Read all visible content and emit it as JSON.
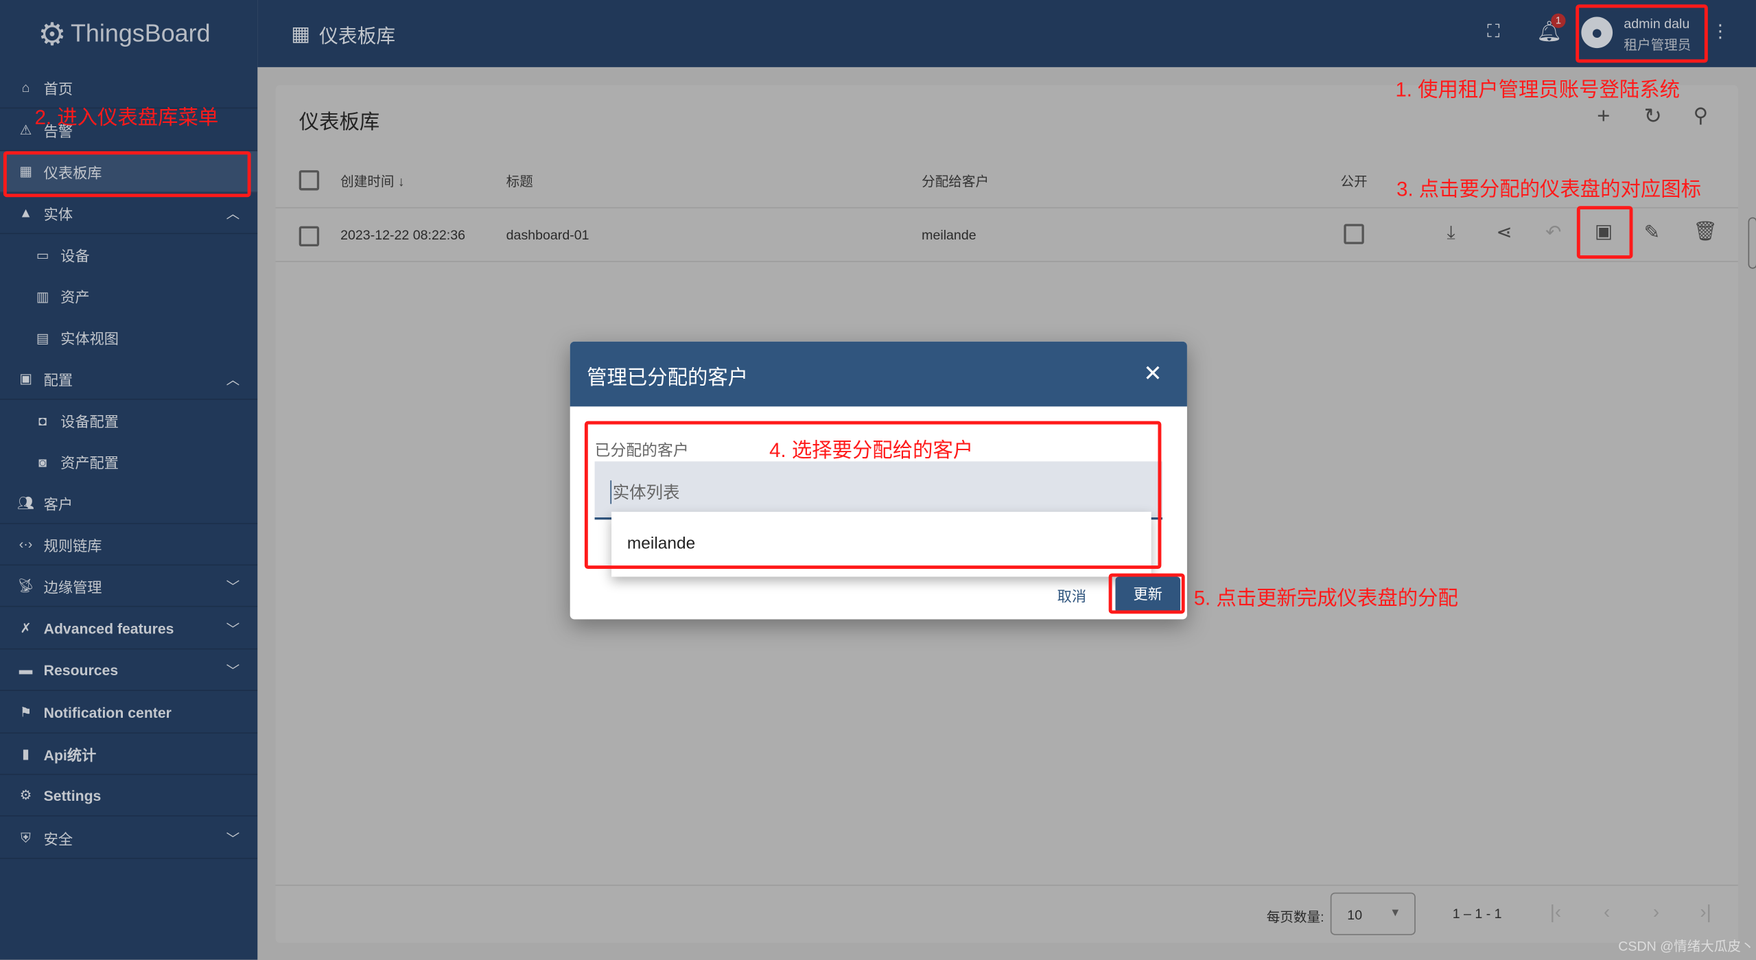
{
  "app": {
    "brand": "ThingsBoard",
    "page_title": "仪表板库"
  },
  "colors": {
    "primary": "#305680",
    "sidebar": "#213858",
    "annotation": "#ff1a1a",
    "badge": "#c62828"
  },
  "sidebar": {
    "items": [
      {
        "label": "首页",
        "icon": "home-icon"
      },
      {
        "label": "告警",
        "icon": "warning-icon"
      },
      {
        "label": "仪表板库",
        "icon": "dashboard-icon",
        "selected": true
      },
      {
        "label": "实体",
        "icon": "shapes-icon",
        "expanded": true
      },
      {
        "label": "设备",
        "icon": "devices-icon",
        "sub": true
      },
      {
        "label": "资产",
        "icon": "domain-icon",
        "sub": true
      },
      {
        "label": "实体视图",
        "icon": "view-quilt-icon",
        "sub": true
      },
      {
        "label": "配置",
        "icon": "settings-box-icon",
        "expanded": true
      },
      {
        "label": "设备配置",
        "icon": "device-profile-icon",
        "sub": true
      },
      {
        "label": "资产配置",
        "icon": "asset-profile-icon",
        "sub": true
      },
      {
        "label": "客户",
        "icon": "people-icon"
      },
      {
        "label": "规则链库",
        "icon": "settings-ethernet-icon"
      },
      {
        "label": "边缘管理",
        "icon": "router-icon",
        "collapsed": true
      },
      {
        "label": "Advanced features",
        "icon": "build-icon",
        "collapsed": true
      },
      {
        "label": "Resources",
        "icon": "folder-icon",
        "collapsed": true
      },
      {
        "label": "Notification center",
        "icon": "notification-icon"
      },
      {
        "label": "Api统计",
        "icon": "analytics-icon"
      },
      {
        "label": "Settings",
        "icon": "gear-icon"
      },
      {
        "label": "安全",
        "icon": "security-icon",
        "collapsed": true
      }
    ]
  },
  "topbar": {
    "notification_count": "1",
    "user_name": "admin dalu",
    "user_role": "租户管理员"
  },
  "table": {
    "title": "仪表板库",
    "columns": [
      "创建时间",
      "标题",
      "分配给客户",
      "公开"
    ],
    "rows": [
      {
        "created": "2023-12-22 08:22:36",
        "title": "dashboard-01",
        "customer": "meilande",
        "public": false
      }
    ]
  },
  "pagination": {
    "page_size_label": "每页数量:",
    "page_size": "10",
    "range": "1 – 1 - 1"
  },
  "dialog": {
    "title": "管理已分配的客户",
    "field_label": "已分配的客户",
    "placeholder": "实体列表",
    "options": [
      "meilande"
    ],
    "cancel": "取消",
    "update": "更新"
  },
  "annotations": {
    "a1": "1. 使用租户管理员账号登陆系统",
    "a2": "2. 进入仪表盘库菜单",
    "a3": "3. 点击要分配的仪表盘的对应图标",
    "a4": "4. 选择要分配给的客户",
    "a5": "5. 点击更新完成仪表盘的分配"
  },
  "watermark": "CSDN @情绪大瓜皮丶"
}
